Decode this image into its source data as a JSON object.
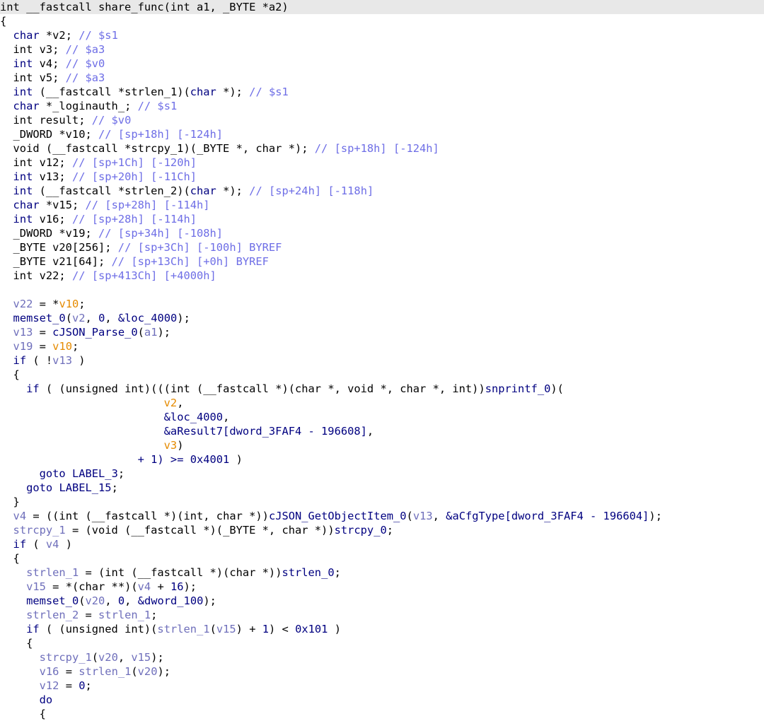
{
  "accent_colors": {
    "keyword": "#000080",
    "comment": "#6e6ee6",
    "local_variable": "#6f6fbb",
    "global_name": "#1a6dd6",
    "argument": "#e58a00",
    "header_background": "#e8e8e8"
  },
  "lines": [
    [
      [
        "d",
        "int __fastcall share_func(int a1, _BYTE *a2)"
      ]
    ],
    [
      [
        "d",
        "{"
      ]
    ],
    [
      [
        "d",
        "  "
      ],
      [
        "k",
        "char"
      ],
      [
        "d",
        " *v2; "
      ],
      [
        "c",
        "// $s1"
      ]
    ],
    [
      [
        "d",
        "  int v3; "
      ],
      [
        "c",
        "// $a3"
      ]
    ],
    [
      [
        "d",
        "  "
      ],
      [
        "k",
        "int"
      ],
      [
        "d",
        " v4; "
      ],
      [
        "c",
        "// $v0"
      ]
    ],
    [
      [
        "d",
        "  int v5; "
      ],
      [
        "c",
        "// $a3"
      ]
    ],
    [
      [
        "d",
        "  "
      ],
      [
        "k",
        "int"
      ],
      [
        "d",
        " (__fastcall *strlen_1)("
      ],
      [
        "k",
        "char"
      ],
      [
        "d",
        " *); "
      ],
      [
        "c",
        "// $s1"
      ]
    ],
    [
      [
        "d",
        "  "
      ],
      [
        "k",
        "char"
      ],
      [
        "d",
        " *_loginauth_; "
      ],
      [
        "c",
        "// $s1"
      ]
    ],
    [
      [
        "d",
        "  int result; "
      ],
      [
        "c",
        "// $v0"
      ]
    ],
    [
      [
        "d",
        "  _DWORD *v10; "
      ],
      [
        "c",
        "// [sp+18h] [-124h]"
      ]
    ],
    [
      [
        "d",
        "  void (__fastcall *strcpy_1)(_BYTE *, char *); "
      ],
      [
        "c",
        "// [sp+18h] [-124h]"
      ]
    ],
    [
      [
        "d",
        "  int v12; "
      ],
      [
        "c",
        "// [sp+1Ch] [-120h]"
      ]
    ],
    [
      [
        "d",
        "  "
      ],
      [
        "k",
        "int"
      ],
      [
        "d",
        " v13; "
      ],
      [
        "c",
        "// [sp+20h] [-11Ch]"
      ]
    ],
    [
      [
        "d",
        "  "
      ],
      [
        "k",
        "int"
      ],
      [
        "d",
        " (__fastcall *strlen_2)("
      ],
      [
        "k",
        "char"
      ],
      [
        "d",
        " *); "
      ],
      [
        "c",
        "// [sp+24h] [-118h]"
      ]
    ],
    [
      [
        "d",
        "  "
      ],
      [
        "k",
        "char"
      ],
      [
        "d",
        " *v15; "
      ],
      [
        "c",
        "// [sp+28h] [-114h]"
      ]
    ],
    [
      [
        "d",
        "  "
      ],
      [
        "k",
        "int"
      ],
      [
        "d",
        " v16; "
      ],
      [
        "c",
        "// [sp+28h] [-114h]"
      ]
    ],
    [
      [
        "d",
        "  _DWORD *v19; "
      ],
      [
        "c",
        "// [sp+34h] [-108h]"
      ]
    ],
    [
      [
        "d",
        "  _BYTE v20[256]; "
      ],
      [
        "c",
        "// [sp+3Ch] [-100h] BYREF"
      ]
    ],
    [
      [
        "d",
        "  _BYTE v21[64]; "
      ],
      [
        "c",
        "// [sp+13Ch] [+0h] BYREF"
      ]
    ],
    [
      [
        "d",
        "  int v22; "
      ],
      [
        "c",
        "// [sp+413Ch] [+4000h]"
      ]
    ],
    [
      [
        "d",
        ""
      ]
    ],
    [
      [
        "d",
        "  "
      ],
      [
        "v",
        "v22"
      ],
      [
        "d",
        " = *"
      ],
      [
        "o",
        "v10"
      ],
      [
        "d",
        ";"
      ]
    ],
    [
      [
        "d",
        "  "
      ],
      [
        "f",
        "memset_0"
      ],
      [
        "d",
        "("
      ],
      [
        "v",
        "v2"
      ],
      [
        "d",
        ", "
      ],
      [
        "n",
        "0"
      ],
      [
        "d",
        ", "
      ],
      [
        "n",
        "&loc_4000"
      ],
      [
        "d",
        ");"
      ]
    ],
    [
      [
        "d",
        "  "
      ],
      [
        "v",
        "v13"
      ],
      [
        "d",
        " = "
      ],
      [
        "f",
        "cJSON_Parse_0"
      ],
      [
        "d",
        "("
      ],
      [
        "v",
        "a1"
      ],
      [
        "d",
        ");"
      ]
    ],
    [
      [
        "d",
        "  "
      ],
      [
        "v",
        "v19"
      ],
      [
        "d",
        " = "
      ],
      [
        "o",
        "v10"
      ],
      [
        "d",
        ";"
      ]
    ],
    [
      [
        "d",
        "  "
      ],
      [
        "k",
        "if"
      ],
      [
        "d",
        " ( !"
      ],
      [
        "v",
        "v13"
      ],
      [
        "d",
        " )"
      ]
    ],
    [
      [
        "d",
        "  {"
      ]
    ],
    [
      [
        "d",
        "    "
      ],
      [
        "k",
        "if"
      ],
      [
        "d",
        " ( (unsigned int)(((int (__fastcall *)(char *, void *, char *, int))"
      ],
      [
        "f",
        "snprintf_0"
      ],
      [
        "d",
        ")("
      ]
    ],
    [
      [
        "d",
        "                         "
      ],
      [
        "o",
        "v2"
      ],
      [
        "d",
        ","
      ]
    ],
    [
      [
        "d",
        "                         "
      ],
      [
        "n",
        "&loc_4000"
      ],
      [
        "d",
        ","
      ]
    ],
    [
      [
        "d",
        "                         "
      ],
      [
        "n",
        "&aResult7[dword_3FAF4 - 196608]"
      ],
      [
        "d",
        ","
      ]
    ],
    [
      [
        "d",
        "                         "
      ],
      [
        "o",
        "v3"
      ],
      [
        "d",
        ")"
      ]
    ],
    [
      [
        "d",
        "                     "
      ],
      [
        "n",
        "+ 1) >= 0x4001"
      ],
      [
        "d",
        " )"
      ]
    ],
    [
      [
        "d",
        "      "
      ],
      [
        "k",
        "goto"
      ],
      [
        "d",
        " "
      ],
      [
        "n",
        "LABEL_3"
      ],
      [
        "d",
        ";"
      ]
    ],
    [
      [
        "d",
        "    "
      ],
      [
        "k",
        "goto"
      ],
      [
        "d",
        " "
      ],
      [
        "n",
        "LABEL_15"
      ],
      [
        "d",
        ";"
      ]
    ],
    [
      [
        "d",
        "  }"
      ]
    ],
    [
      [
        "d",
        "  "
      ],
      [
        "v",
        "v4"
      ],
      [
        "d",
        " = ((int (__fastcall *)(int, char *))"
      ],
      [
        "f",
        "cJSON_GetObjectItem_0"
      ],
      [
        "d",
        "("
      ],
      [
        "v",
        "v13"
      ],
      [
        "d",
        ", "
      ],
      [
        "n",
        "&aCfgType[dword_3FAF4 - 196604]"
      ],
      [
        "d",
        ");"
      ]
    ],
    [
      [
        "d",
        "  "
      ],
      [
        "v",
        "strcpy_1"
      ],
      [
        "d",
        " = (void (__fastcall *)(_BYTE *, char *))"
      ],
      [
        "f",
        "strcpy_0"
      ],
      [
        "d",
        ";"
      ]
    ],
    [
      [
        "d",
        "  "
      ],
      [
        "k",
        "if"
      ],
      [
        "d",
        " ( "
      ],
      [
        "v",
        "v4"
      ],
      [
        "d",
        " )"
      ]
    ],
    [
      [
        "d",
        "  {"
      ]
    ],
    [
      [
        "d",
        "    "
      ],
      [
        "v",
        "strlen_1"
      ],
      [
        "d",
        " = (int (__fastcall *)(char *))"
      ],
      [
        "f",
        "strlen_0"
      ],
      [
        "d",
        ";"
      ]
    ],
    [
      [
        "d",
        "    "
      ],
      [
        "v",
        "v15"
      ],
      [
        "d",
        " = *(char **)("
      ],
      [
        "v",
        "v4"
      ],
      [
        "d",
        " + "
      ],
      [
        "n",
        "16"
      ],
      [
        "d",
        ");"
      ]
    ],
    [
      [
        "d",
        "    "
      ],
      [
        "f",
        "memset_0"
      ],
      [
        "d",
        "("
      ],
      [
        "v",
        "v20"
      ],
      [
        "d",
        ", "
      ],
      [
        "n",
        "0"
      ],
      [
        "d",
        ", "
      ],
      [
        "n",
        "&dword_100"
      ],
      [
        "d",
        ");"
      ]
    ],
    [
      [
        "d",
        "    "
      ],
      [
        "v",
        "strlen_2"
      ],
      [
        "d",
        " = "
      ],
      [
        "v",
        "strlen_1"
      ],
      [
        "d",
        ";"
      ]
    ],
    [
      [
        "d",
        "    "
      ],
      [
        "k",
        "if"
      ],
      [
        "d",
        " ( (unsigned int)("
      ],
      [
        "v",
        "strlen_1"
      ],
      [
        "d",
        "("
      ],
      [
        "v",
        "v15"
      ],
      [
        "d",
        ") + "
      ],
      [
        "n",
        "1"
      ],
      [
        "d",
        ") < "
      ],
      [
        "n",
        "0x101"
      ],
      [
        "d",
        " )"
      ]
    ],
    [
      [
        "d",
        "    {"
      ]
    ],
    [
      [
        "d",
        "      "
      ],
      [
        "v",
        "strcpy_1"
      ],
      [
        "d",
        "("
      ],
      [
        "v",
        "v20"
      ],
      [
        "d",
        ", "
      ],
      [
        "v",
        "v15"
      ],
      [
        "d",
        ");"
      ]
    ],
    [
      [
        "d",
        "      "
      ],
      [
        "v",
        "v16"
      ],
      [
        "d",
        " = "
      ],
      [
        "v",
        "strlen_1"
      ],
      [
        "d",
        "("
      ],
      [
        "v",
        "v20"
      ],
      [
        "d",
        ");"
      ]
    ],
    [
      [
        "d",
        "      "
      ],
      [
        "v",
        "v12"
      ],
      [
        "d",
        " = "
      ],
      [
        "n",
        "0"
      ],
      [
        "d",
        ";"
      ]
    ],
    [
      [
        "k",
        "      do"
      ]
    ],
    [
      [
        "d",
        "      {"
      ]
    ]
  ]
}
